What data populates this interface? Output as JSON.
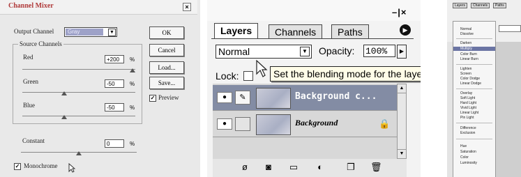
{
  "channel_mixer": {
    "title": "Channel Mixer",
    "close_glyph": "×",
    "output_channel_label": "Output Channel",
    "output_channel_value": "Gray",
    "source_channels_label": "Source Channels",
    "red_label": "Red",
    "red_value": "+200",
    "green_label": "Green",
    "green_value": "-50",
    "blue_label": "Blue",
    "blue_value": "-50",
    "constant_label": "Constant",
    "constant_value": "0",
    "percent": "%",
    "ok_label": "OK",
    "cancel_label": "Cancel",
    "load_label": "Load...",
    "save_label": "Save...",
    "preview_label": "Preview",
    "preview_checked": true,
    "monochrome_label": "Monochrome",
    "monochrome_checked": true
  },
  "layers_panel": {
    "window_controls": "–|×",
    "tabs": [
      {
        "label": "Layers",
        "active": true
      },
      {
        "label": "Channels",
        "active": false
      },
      {
        "label": "Paths",
        "active": false
      }
    ],
    "blend_mode": "Normal",
    "opacity_label": "Opacity:",
    "opacity_value": "100%",
    "lock_label": "Lock:",
    "tooltip": "Set the blending mode for the layer",
    "layers": [
      {
        "name": "Background c...",
        "selected": true,
        "visible": true
      },
      {
        "name": "Background",
        "selected": false,
        "visible": true,
        "locked": true
      }
    ],
    "accent": "#838ca4"
  },
  "blend_menu": {
    "tabs": [
      "Layers",
      "Channels",
      "Paths"
    ],
    "top_items": [
      "Normal",
      "Dissolve"
    ],
    "darken_group": [
      "Darken",
      "Multiply",
      "Color Burn",
      "Linear Burn"
    ],
    "lighten_group": [
      "Lighten",
      "Screen",
      "Color Dodge",
      "Linear Dodge"
    ],
    "contrast_group": [
      "Overlay",
      "Soft Light",
      "Hard Light",
      "Vivid Light",
      "Linear Light",
      "Pin Light"
    ],
    "inversion_group": [
      "Difference",
      "Exclusion"
    ],
    "component_group": [
      "Hue",
      "Saturation",
      "Color",
      "Luminosity"
    ],
    "highlighted_item": "Multiply",
    "highlight_color": "#6b75a4"
  }
}
